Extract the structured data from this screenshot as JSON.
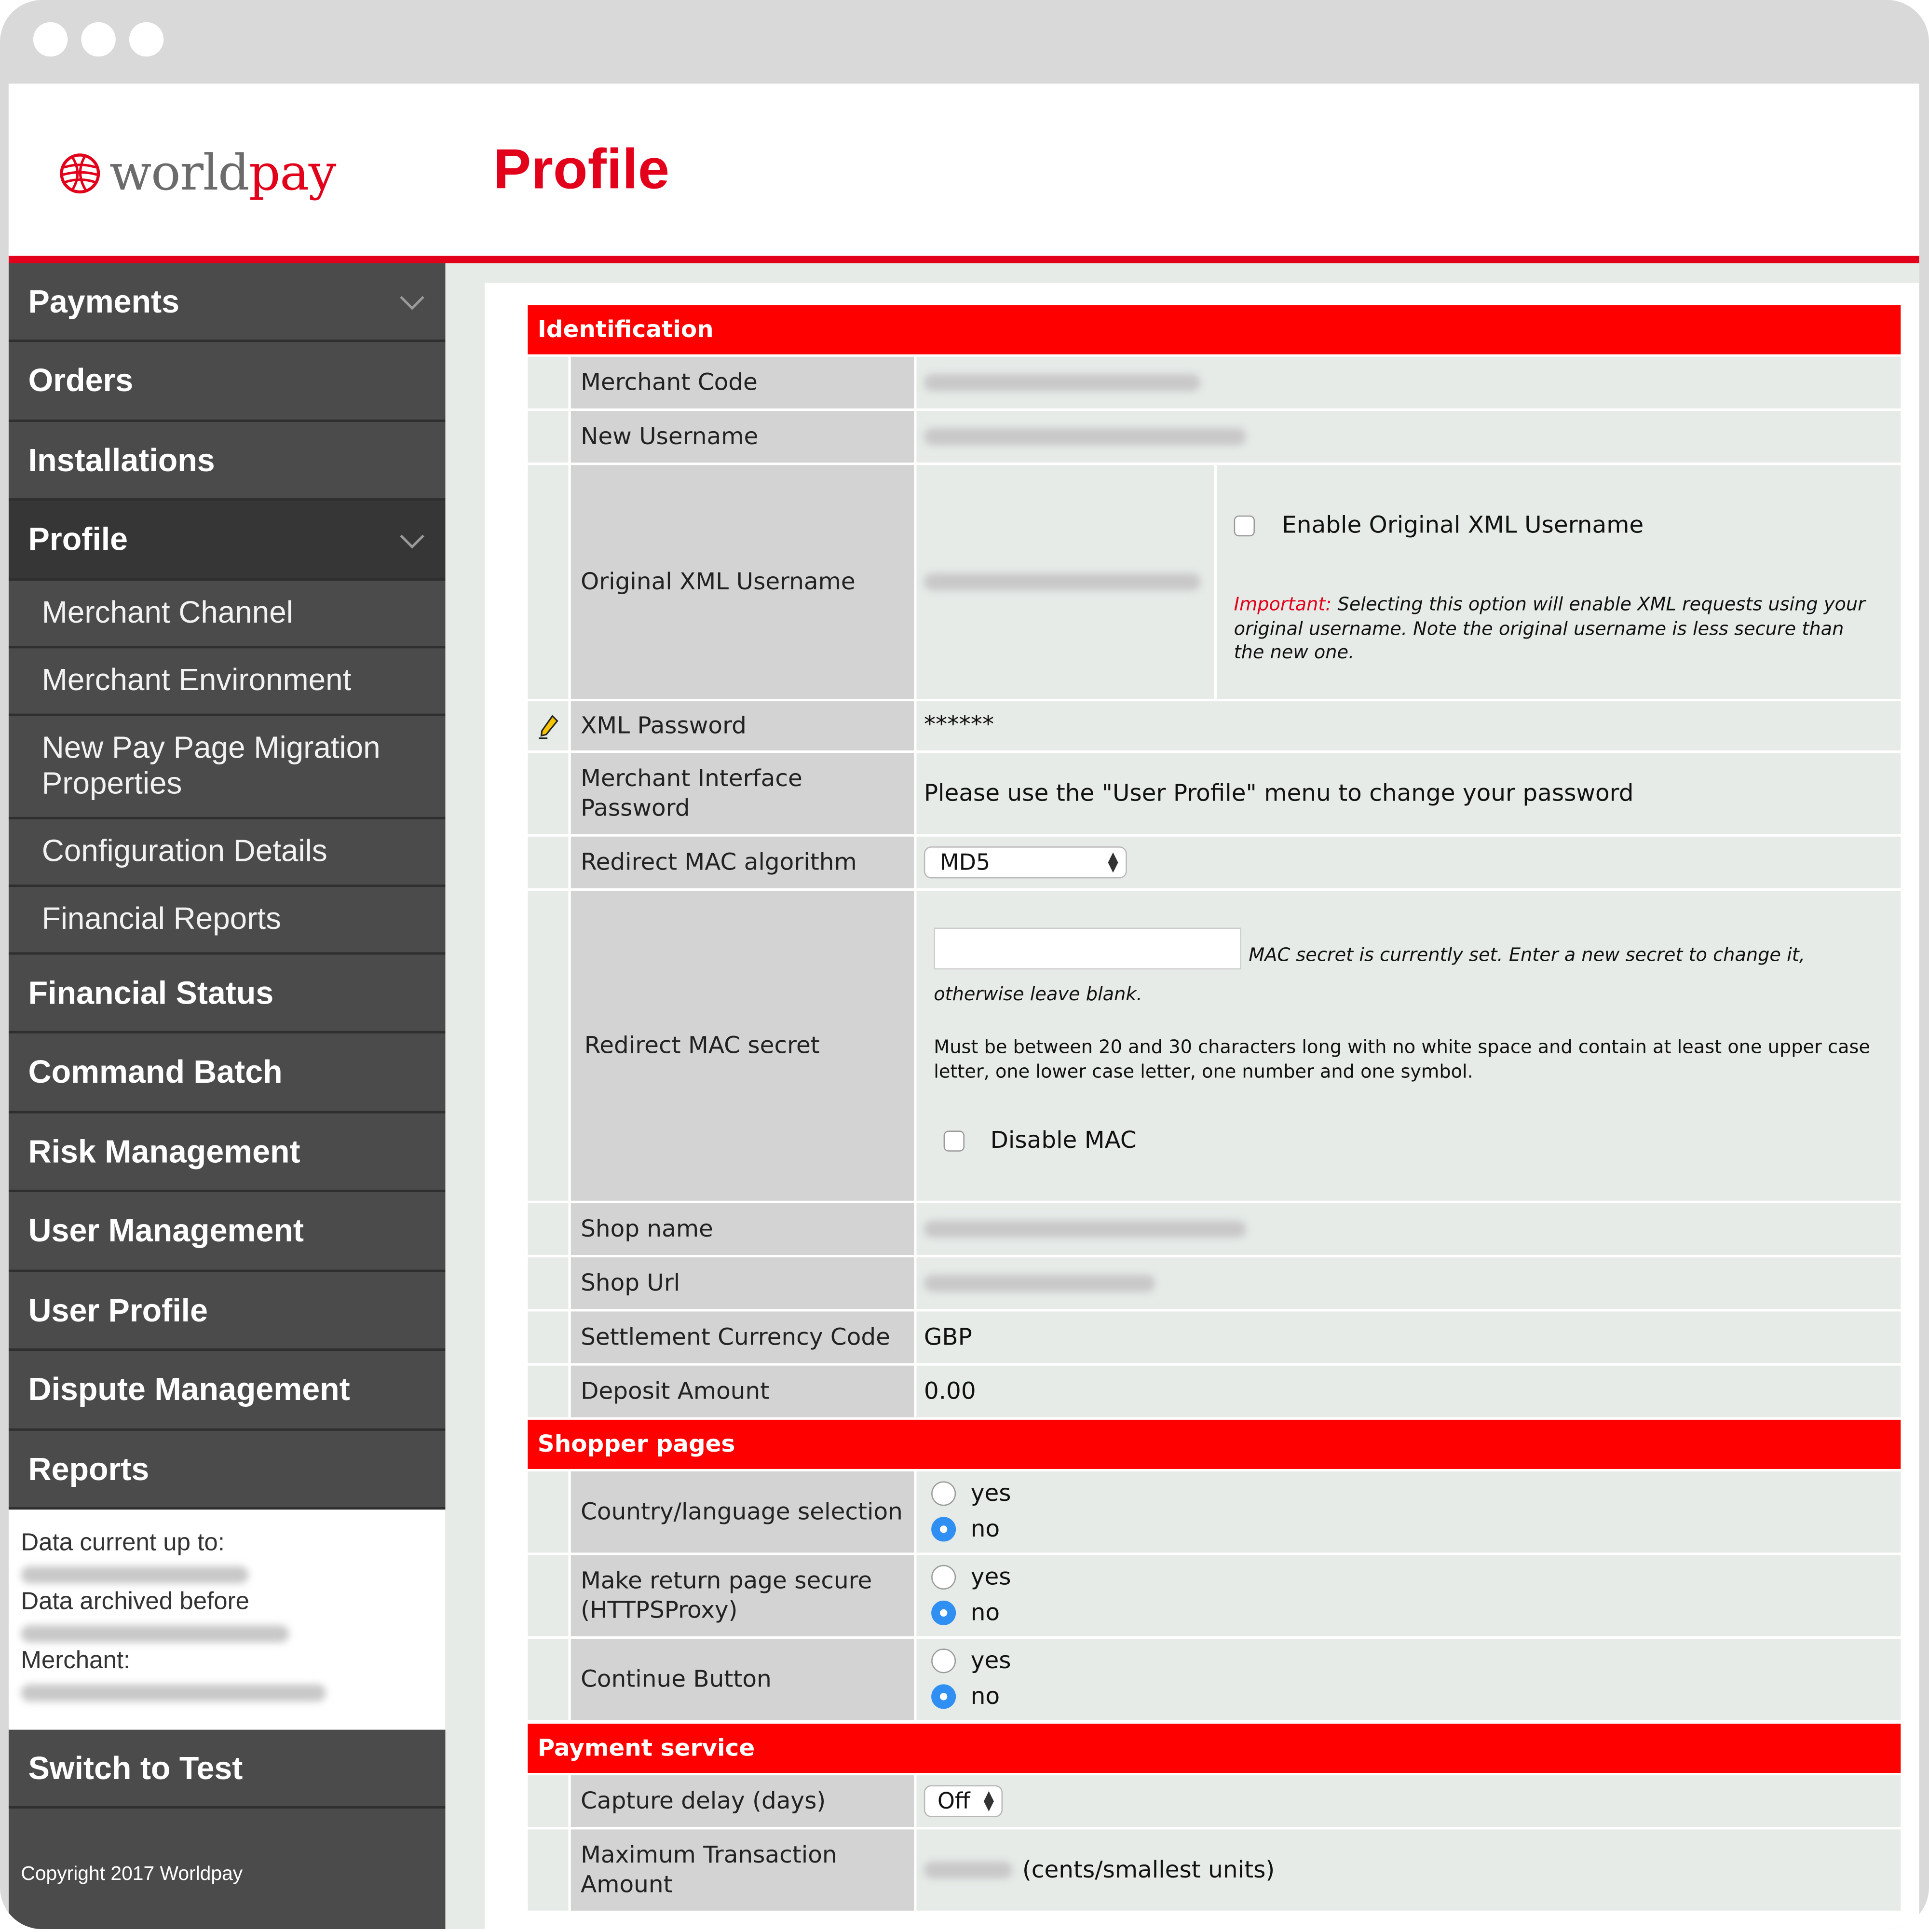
{
  "header": {
    "logo_world": "world",
    "logo_pay": "pay",
    "title": "Profile"
  },
  "sidebar": {
    "items": [
      {
        "label": "Payments",
        "icon": "chevron-down-icon"
      },
      {
        "label": "Orders"
      },
      {
        "label": "Installations"
      },
      {
        "label": "Profile",
        "icon": "chevron-down-icon",
        "active": true
      },
      {
        "label": "Merchant Channel",
        "sub": true
      },
      {
        "label": "Merchant Environment",
        "sub": true
      },
      {
        "label": "New Pay Page Migration Properties",
        "sub": true
      },
      {
        "label": "Configuration Details",
        "sub": true
      },
      {
        "label": "Financial Reports",
        "sub": true
      },
      {
        "label": "Financial Status"
      },
      {
        "label": "Command Batch"
      },
      {
        "label": "Risk Management"
      },
      {
        "label": "User Management"
      },
      {
        "label": "User Profile"
      },
      {
        "label": "Dispute Management"
      },
      {
        "label": "Reports"
      }
    ],
    "info": {
      "data_current_label": "Data current up to:",
      "data_archived_label": "Data archived before",
      "merchant_label": "Merchant:"
    },
    "switch_label": "Switch to Test",
    "copyright": "Copyright 2017 Worldpay"
  },
  "identification": {
    "title": "Identification",
    "merchant_code_label": "Merchant Code",
    "new_username_label": "New Username",
    "original_xml_label": "Original XML Username",
    "enable_original_label": "Enable Original XML Username",
    "important_prefix": "Important:",
    "important_text": "Selecting this option will enable XML requests using your original username. Note the original username is less secure than the new one.",
    "xml_password_label": "XML Password",
    "xml_password_value": "******",
    "mi_password_label": "Merchant Interface Password",
    "mi_password_value": "Please use the \"User Profile\" menu to change your password",
    "mac_algorithm_label": "Redirect MAC algorithm",
    "mac_algorithm_value": "MD5",
    "mac_secret_label": "Redirect MAC secret",
    "mac_secret_note": "MAC secret is currently set. Enter a new secret to change it, otherwise leave blank.",
    "mac_secret_rules": "Must be between 20 and 30 characters long with no white space and contain at least one upper case letter, one lower case letter, one number and one symbol.",
    "disable_mac_label": "Disable MAC",
    "shop_name_label": "Shop name",
    "shop_url_label": "Shop Url",
    "currency_label": "Settlement Currency Code",
    "currency_value": "GBP",
    "deposit_label": "Deposit Amount",
    "deposit_value": "0.00"
  },
  "shopper_pages": {
    "title": "Shopper pages",
    "rows": [
      {
        "label": "Country/language selection",
        "yes": "yes",
        "no": "no",
        "selected": "no"
      },
      {
        "label": "Make return page secure (HTTPSProxy)",
        "yes": "yes",
        "no": "no",
        "selected": "no"
      },
      {
        "label": "Continue Button",
        "yes": "yes",
        "no": "no",
        "selected": "no"
      }
    ]
  },
  "payment_service": {
    "title": "Payment service",
    "capture_delay_label": "Capture delay (days)",
    "capture_delay_value": "Off",
    "max_amount_label": "Maximum Transaction Amount",
    "max_amount_unit": "(cents/smallest units)"
  },
  "colors": {
    "brand_red": "#e2001a",
    "section_red": "#ff0000",
    "sidebar": "#4b4b4b",
    "radio_selected": "#2f8ff3"
  }
}
